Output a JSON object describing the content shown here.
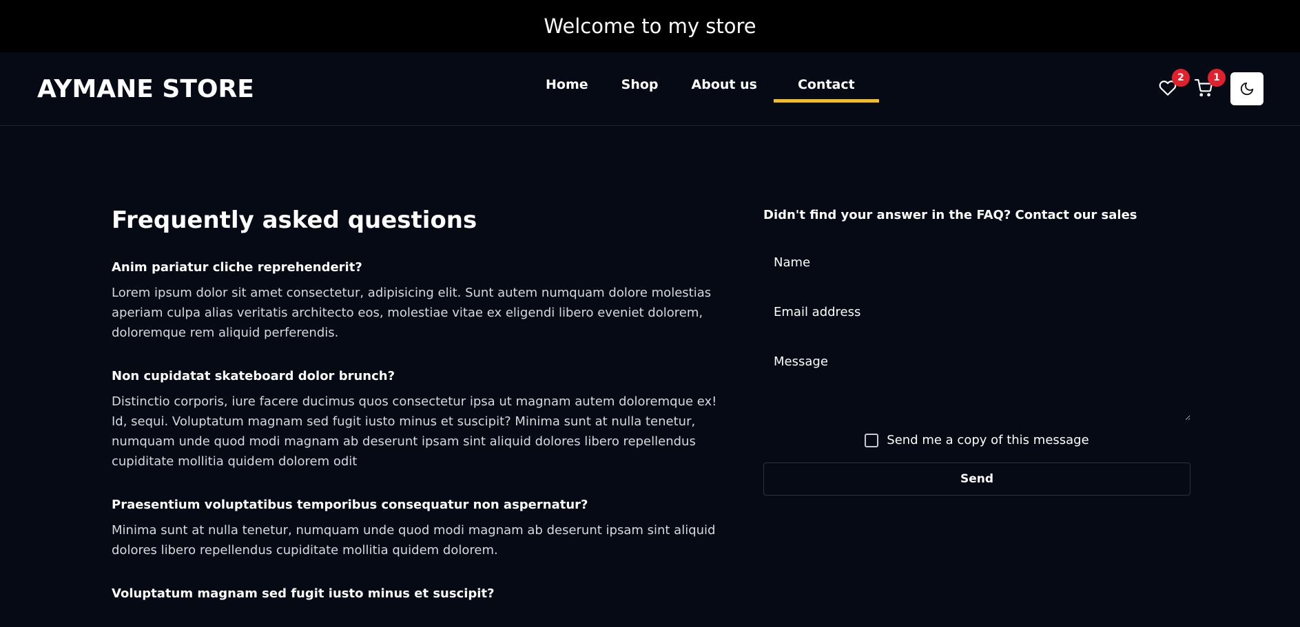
{
  "announcement": "Welcome to my store",
  "brand": "AYMANE STORE",
  "nav": {
    "items": [
      {
        "label": "Home"
      },
      {
        "label": "Shop"
      },
      {
        "label": "About us"
      },
      {
        "label": "Contact",
        "active": true
      }
    ]
  },
  "icons": {
    "wishlist": {
      "icon": "heart-icon",
      "count": "2"
    },
    "cart": {
      "icon": "cart-icon",
      "count": "1"
    },
    "theme": {
      "icon": "moon-icon"
    }
  },
  "colors": {
    "accent": "#f5bd1f",
    "badge": "#e0212e",
    "background": "#050a14"
  },
  "faq": {
    "title": "Frequently asked questions",
    "items": [
      {
        "question": "Anim pariatur cliche reprehenderit?",
        "answer": "Lorem ipsum dolor sit amet consectetur, adipisicing elit. Sunt autem numquam dolore molestias aperiam culpa alias veritatis architecto eos, molestiae vitae ex eligendi libero eveniet dolorem, doloremque rem aliquid perferendis."
      },
      {
        "question": "Non cupidatat skateboard dolor brunch?",
        "answer": "Distinctio corporis, iure facere ducimus quos consectetur ipsa ut magnam autem doloremque ex! Id, sequi. Voluptatum magnam sed fugit iusto minus et suscipit? Minima sunt at nulla tenetur, numquam unde quod modi magnam ab deserunt ipsam sint aliquid dolores libero repellendus cupiditate mollitia quidem dolorem odit"
      },
      {
        "question": "Praesentium voluptatibus temporibus consequatur non aspernatur?",
        "answer": "Minima sunt at nulla tenetur, numquam unde quod modi magnam ab deserunt ipsam sint aliquid dolores libero repellendus cupiditate mollitia quidem dolorem."
      },
      {
        "question": "Voluptatum magnam sed fugit iusto minus et suscipit?",
        "answer": ""
      }
    ]
  },
  "contact": {
    "title": "Didn't find your answer in the FAQ? Contact our sales",
    "name_placeholder": "Name",
    "email_placeholder": "Email address",
    "message_placeholder": "Message",
    "copy_label": "Send me a copy of this message",
    "send_label": "Send"
  }
}
